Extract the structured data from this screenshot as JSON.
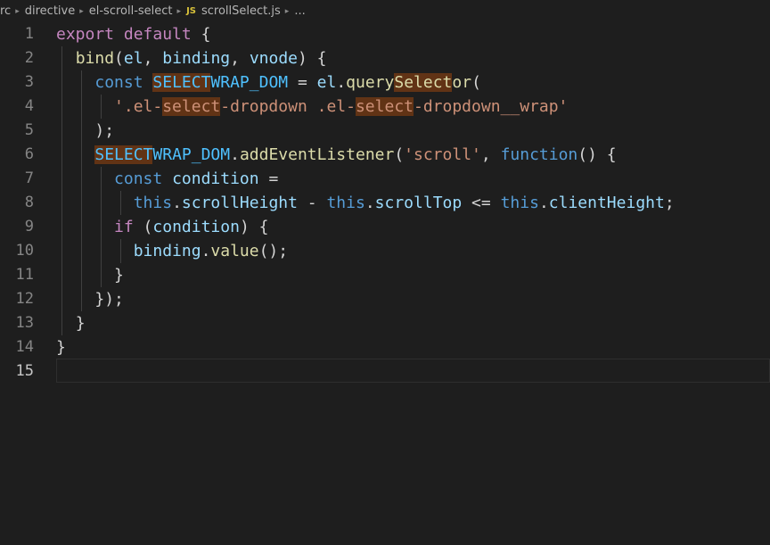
{
  "breadcrumb": {
    "items": [
      "rc",
      "directive",
      "el-scroll-select"
    ],
    "file_badge": "JS",
    "file_name": "scrollSelect.js",
    "ellipsis": "..."
  },
  "editor": {
    "lines": [
      {
        "number": "1",
        "tokens": [
          {
            "t": "export",
            "c": "kw"
          },
          {
            "t": " "
          },
          {
            "t": "default",
            "c": "kw"
          },
          {
            "t": " {",
            "c": "p"
          }
        ]
      },
      {
        "number": "2",
        "tokens": [
          {
            "t": "  "
          },
          {
            "t": "bind",
            "c": "fn"
          },
          {
            "t": "(",
            "c": "p"
          },
          {
            "t": "el",
            "c": "vr"
          },
          {
            "t": ", ",
            "c": "p"
          },
          {
            "t": "binding",
            "c": "vr"
          },
          {
            "t": ", ",
            "c": "p"
          },
          {
            "t": "vnode",
            "c": "vr"
          },
          {
            "t": ") {",
            "c": "p"
          }
        ]
      },
      {
        "number": "3",
        "tokens": [
          {
            "t": "    "
          },
          {
            "t": "const",
            "c": "st"
          },
          {
            "t": " "
          },
          {
            "t": "SELECT",
            "c": "cn hl"
          },
          {
            "t": "WRAP_DOM",
            "c": "cn"
          },
          {
            "t": " = ",
            "c": "p"
          },
          {
            "t": "el",
            "c": "vr"
          },
          {
            "t": ".",
            "c": "p"
          },
          {
            "t": "query",
            "c": "fn"
          },
          {
            "t": "Select",
            "c": "fn hl"
          },
          {
            "t": "or",
            "c": "fn"
          },
          {
            "t": "(",
            "c": "p"
          }
        ]
      },
      {
        "number": "4",
        "tokens": [
          {
            "t": "      "
          },
          {
            "t": "'.el-",
            "c": "s"
          },
          {
            "t": "select",
            "c": "s hl"
          },
          {
            "t": "-dropdown .el-",
            "c": "s"
          },
          {
            "t": "select",
            "c": "s hl"
          },
          {
            "t": "-dropdown__wrap'",
            "c": "s"
          }
        ]
      },
      {
        "number": "5",
        "tokens": [
          {
            "t": "    "
          },
          {
            "t": ");",
            "c": "p"
          }
        ]
      },
      {
        "number": "6",
        "tokens": [
          {
            "t": "    "
          },
          {
            "t": "SELECT",
            "c": "cn hl"
          },
          {
            "t": "WRAP_DOM",
            "c": "cn"
          },
          {
            "t": ".",
            "c": "p"
          },
          {
            "t": "addEventListener",
            "c": "fn"
          },
          {
            "t": "(",
            "c": "p"
          },
          {
            "t": "'scroll'",
            "c": "s"
          },
          {
            "t": ", ",
            "c": "p"
          },
          {
            "t": "function",
            "c": "st"
          },
          {
            "t": "() {",
            "c": "p"
          }
        ]
      },
      {
        "number": "7",
        "tokens": [
          {
            "t": "      "
          },
          {
            "t": "const",
            "c": "st"
          },
          {
            "t": " "
          },
          {
            "t": "condition",
            "c": "vr"
          },
          {
            "t": " =",
            "c": "p"
          }
        ]
      },
      {
        "number": "8",
        "tokens": [
          {
            "t": "        "
          },
          {
            "t": "this",
            "c": "st"
          },
          {
            "t": ".",
            "c": "p"
          },
          {
            "t": "scrollHeight",
            "c": "vr"
          },
          {
            "t": " - ",
            "c": "p"
          },
          {
            "t": "this",
            "c": "st"
          },
          {
            "t": ".",
            "c": "p"
          },
          {
            "t": "scrollTop",
            "c": "vr"
          },
          {
            "t": " <= ",
            "c": "p"
          },
          {
            "t": "this",
            "c": "st"
          },
          {
            "t": ".",
            "c": "p"
          },
          {
            "t": "clientHeight",
            "c": "vr"
          },
          {
            "t": ";",
            "c": "p"
          }
        ]
      },
      {
        "number": "9",
        "tokens": [
          {
            "t": "      "
          },
          {
            "t": "if",
            "c": "kw"
          },
          {
            "t": " (",
            "c": "p"
          },
          {
            "t": "condition",
            "c": "vr"
          },
          {
            "t": ") {",
            "c": "p"
          }
        ]
      },
      {
        "number": "10",
        "tokens": [
          {
            "t": "        "
          },
          {
            "t": "binding",
            "c": "vr"
          },
          {
            "t": ".",
            "c": "p"
          },
          {
            "t": "value",
            "c": "fn"
          },
          {
            "t": "();",
            "c": "p"
          }
        ]
      },
      {
        "number": "11",
        "tokens": [
          {
            "t": "      "
          },
          {
            "t": "}",
            "c": "p"
          }
        ]
      },
      {
        "number": "12",
        "tokens": [
          {
            "t": "    "
          },
          {
            "t": "});",
            "c": "p"
          }
        ]
      },
      {
        "number": "13",
        "tokens": [
          {
            "t": "  "
          },
          {
            "t": "}",
            "c": "p"
          }
        ]
      },
      {
        "number": "14",
        "tokens": [
          {
            "t": "}",
            "c": "p"
          }
        ]
      },
      {
        "number": "15",
        "tokens": []
      }
    ],
    "active_line": 15
  }
}
